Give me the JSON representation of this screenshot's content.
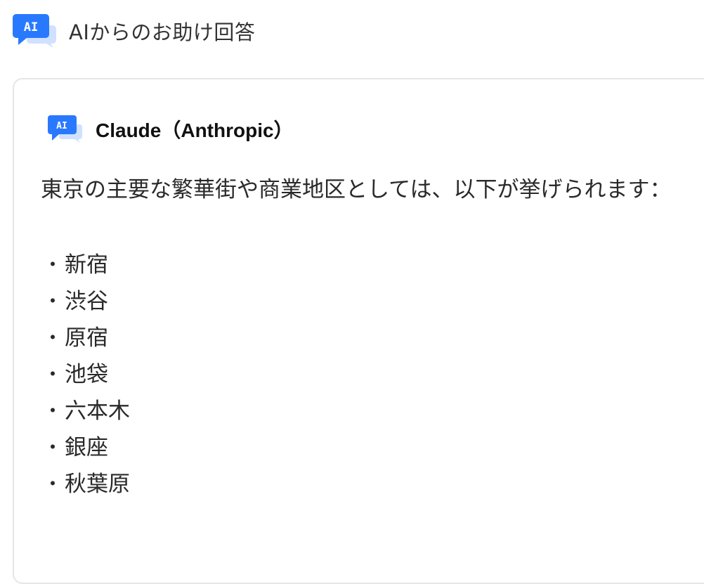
{
  "header": {
    "icon": "ai-chat-icon",
    "icon_text": "AI",
    "title": "AIからのお助け回答"
  },
  "answer_card": {
    "icon": "ai-chat-icon",
    "icon_text": "AI",
    "provider": "Claude（Anthropic）",
    "intro": "東京の主要な繁華街や商業地区としては、以下が挙げられます：",
    "bullet": "・",
    "places": [
      "新宿",
      "渋谷",
      "原宿",
      "池袋",
      "六本木",
      "銀座",
      "秋葉原"
    ]
  },
  "colors": {
    "icon_blue": "#2979ff",
    "icon_light": "#cfe1ff"
  }
}
